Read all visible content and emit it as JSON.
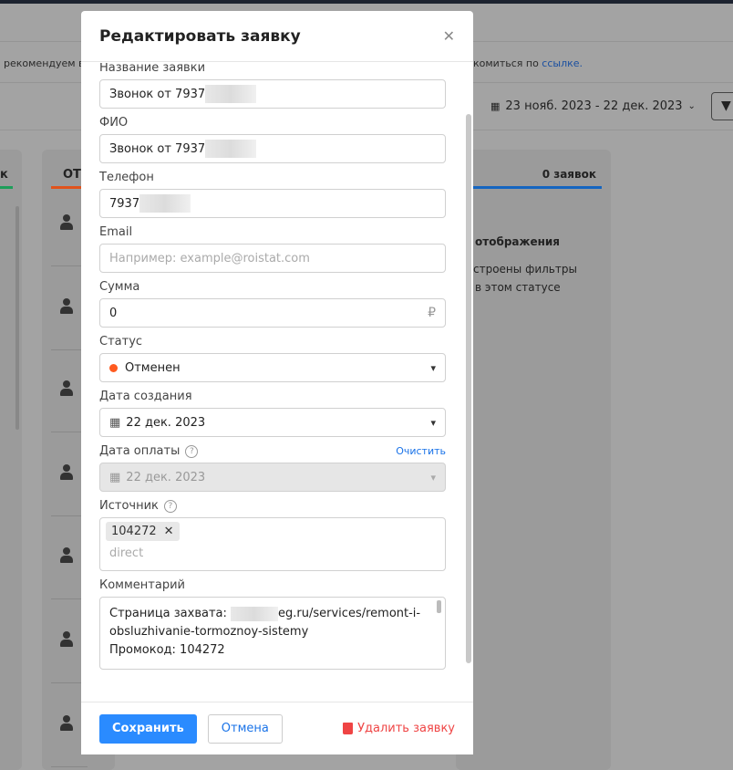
{
  "background": {
    "banner_left": "рекомендуем во",
    "banner_right": "комиться по",
    "banner_link": "ссылке.",
    "date_range": "23 нояб. 2023 - 22 дек. 2023",
    "col_left_title": "к",
    "col_mid_title": "ОТ",
    "col_right_count": "0 заявок",
    "empty_title": "отображения",
    "empty_line1": "строены фильтры",
    "empty_line2": "в этом статусе",
    "colors": {
      "green": "#1e9e5a",
      "orange": "#e0531c",
      "blue": "#1565c0"
    }
  },
  "modal": {
    "title": "Редактировать заявку",
    "fields": {
      "name_label": "Название заявки",
      "name_value": "Звонок от 7937",
      "fio_label": "ФИО",
      "fio_value": "Звонок от 7937",
      "phone_label": "Телефон",
      "phone_value": "7937",
      "email_label": "Email",
      "email_placeholder": "Например: example@roistat.com",
      "sum_label": "Сумма",
      "sum_value": "0",
      "currency": "₽",
      "status_label": "Статус",
      "status_value": "Отменен",
      "status_color": "#ff5a1f",
      "created_label": "Дата создания",
      "created_value": "22 дек. 2023",
      "paid_label": "Дата оплаты",
      "paid_clear": "Очистить",
      "paid_value": "22 дек. 2023",
      "source_label": "Источник",
      "source_tag": "104272",
      "source_placeholder": "direct",
      "comment_label": "Комментарий",
      "comment_line1_prefix": "Страница захвата:",
      "comment_line1_suffix": "eg.ru/services/remont-i-",
      "comment_line2": "obsluzhivanie-tormoznoy-sistemy",
      "comment_line3": "Промокод: 104272"
    },
    "buttons": {
      "save": "Сохранить",
      "cancel": "Отмена",
      "delete": "Удалить заявку"
    }
  }
}
